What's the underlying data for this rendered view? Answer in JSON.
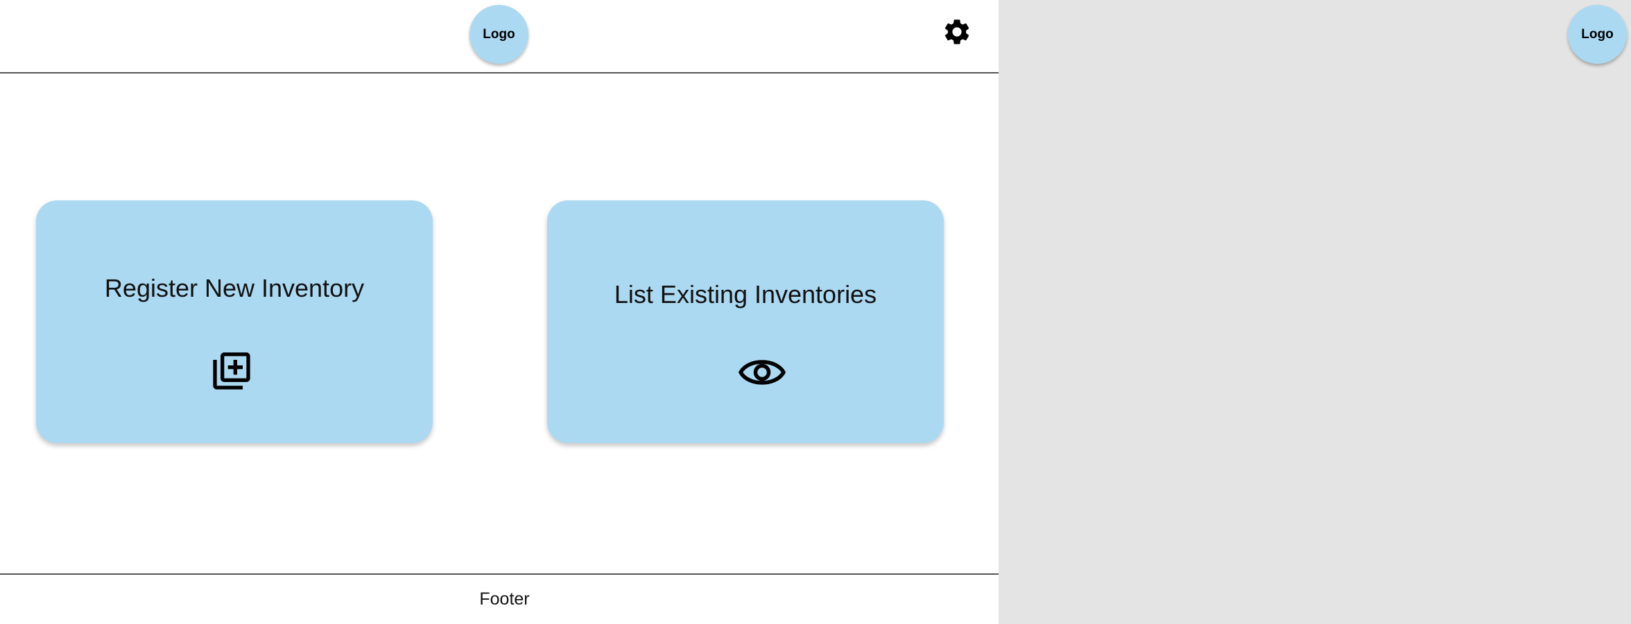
{
  "header": {
    "logo_label": "Logo",
    "settings_icon": "gear-icon"
  },
  "main": {
    "cards": [
      {
        "label": "Register New Inventory",
        "icon": "library-add-icon"
      },
      {
        "label": "List Existing Inventories",
        "icon": "eye-icon"
      }
    ]
  },
  "footer": {
    "label": "Footer"
  },
  "side_panel": {
    "logo_label": "Logo"
  },
  "colors": {
    "card_background": "#acd9f2",
    "logo_background": "#acd9f2",
    "side_panel_background": "#e4e4e4",
    "rule": "#555555"
  }
}
